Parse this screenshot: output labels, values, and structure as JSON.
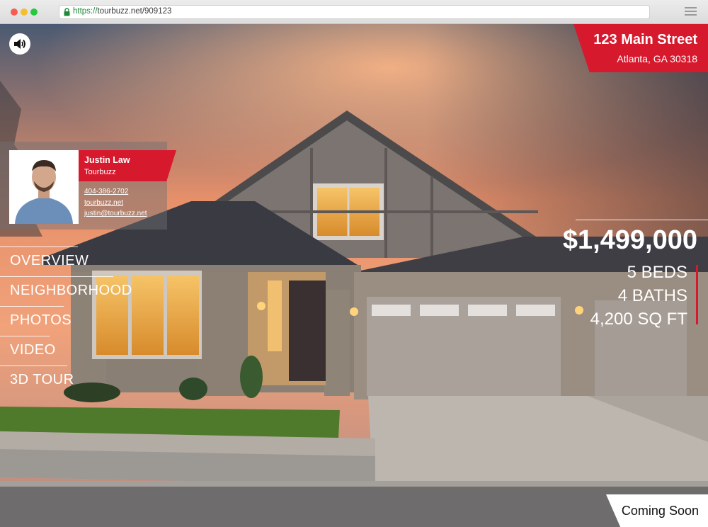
{
  "browser": {
    "url_scheme": "https://",
    "url_rest": "tourbuzz.net/909123"
  },
  "property": {
    "street": "123 Main Street",
    "city_state_zip": "Atlanta, GA 30318",
    "price": "$1,499,000",
    "beds": "5 BEDS",
    "baths": "4 BATHS",
    "sqft": "4,200 SQ FT",
    "status": "Coming Soon"
  },
  "agent": {
    "name": "Justin Law",
    "company": "Tourbuzz",
    "phone": "404-386-2702",
    "website": "tourbuzz.net",
    "email": "justin@tourbuzz.net"
  },
  "nav": {
    "items": [
      {
        "label": "OVERVIEW"
      },
      {
        "label": "NEIGHBORHOOD"
      },
      {
        "label": "PHOTOS"
      },
      {
        "label": "VIDEO"
      },
      {
        "label": "3D TOUR"
      }
    ]
  },
  "icons": {
    "sound": "speaker-volume-icon",
    "lock": "lock-icon",
    "menu": "hamburger-menu-icon"
  },
  "colors": {
    "accent": "#d7192e",
    "chrome": "#dcdcdc"
  }
}
